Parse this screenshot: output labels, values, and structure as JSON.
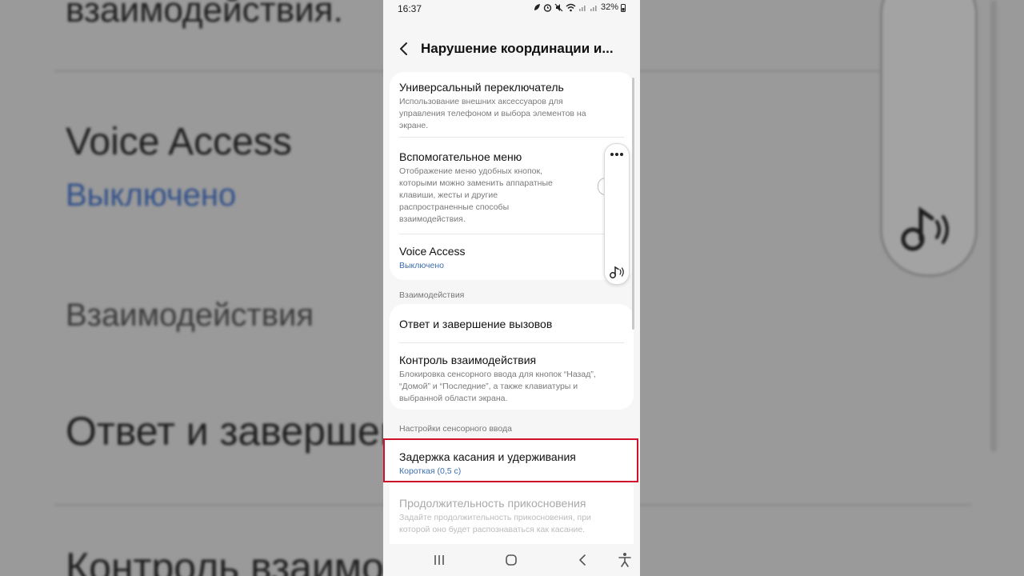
{
  "background": {
    "text_top": "взаимодействия.",
    "voice_access": "Voice Access",
    "voice_status": "Выключено",
    "section": "Взаимодействия",
    "answer_calls": "Ответ и завершение вызовов",
    "control": "Контроль взаимодействия"
  },
  "status_bar": {
    "time": "16:37",
    "battery": "32%"
  },
  "header": {
    "title": "Нарушение координации и..."
  },
  "items": {
    "universal_switch": {
      "title": "Универсальный переключатель",
      "desc": "Использование внешних аксессуаров для управления телефоном и выбора элементов на экране."
    },
    "assistant_menu": {
      "title": "Вспомогательное меню",
      "desc": "Отображение меню удобных кнопок, которыми можно заменить аппаратные клавиши, жесты и другие распространенные способы взаимодействия."
    },
    "voice_access": {
      "title": "Voice Access",
      "status": "Выключено"
    },
    "answer_calls": {
      "title": "Ответ и завершение вызовов"
    },
    "interaction_control": {
      "title": "Контроль взаимодействия",
      "desc": "Блокировка сенсорного ввода для кнопок “Назад”, “Домой” и “Последние”, а также клавиатуры и выбранной области экрана."
    },
    "touch_hold_delay": {
      "title": "Задержка касания и удерживания",
      "status": "Короткая (0,5 с)"
    },
    "touch_duration": {
      "title": "Продолжительность прикосновения",
      "desc": "Задайте продолжительность прикосновения, при которой оно будет распознаваться как касание."
    }
  },
  "sections": {
    "interactions": "Взаимодействия",
    "touch_settings": "Настройки сенсорного ввода"
  },
  "colors": {
    "accent_blue": "#3e6fb0",
    "highlight_red": "#d0112b"
  }
}
